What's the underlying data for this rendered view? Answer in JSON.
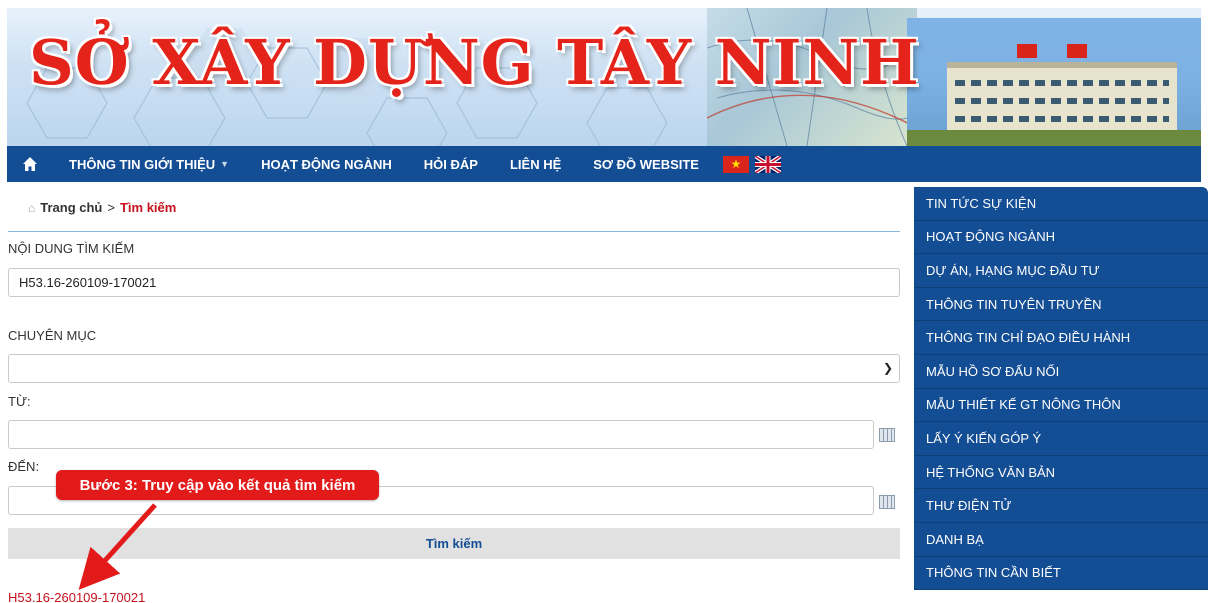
{
  "banner": {
    "title": "SỞ XÂY DỰNG TÂY NINH",
    "title_color": "#e4241b"
  },
  "nav": {
    "home_icon": "home-icon",
    "items": [
      {
        "label": "THÔNG TIN GIỚI THIỆU",
        "has_dropdown": true
      },
      {
        "label": "HOẠT ĐỘNG NGÀNH"
      },
      {
        "label": "HỎI ĐÁP"
      },
      {
        "label": "LIÊN HỆ"
      },
      {
        "label": "SƠ ĐỒ WEBSITE"
      }
    ],
    "background": "#134d94"
  },
  "breadcrumb": {
    "home": "Trang chủ",
    "separator": ">",
    "current": "Tìm kiếm"
  },
  "form": {
    "content_label": "NỘI DUNG TÌM KIẾM",
    "content_value": "H53.16-260109-170021",
    "category_label": "CHUYÊN MỤC",
    "category_value": "",
    "from_label": "TỪ:",
    "from_value": "",
    "to_label": "ĐẾN:",
    "to_value": "",
    "search_button": "Tìm kiếm"
  },
  "callout": {
    "text": "Bước 3: Truy cập vào kết quả tìm kiếm",
    "color": "#e21a1a"
  },
  "results": [
    {
      "text": "H53.16-260109-170021"
    }
  ],
  "sidebar": {
    "items": [
      {
        "label": "TIN TỨC SỰ KIỆN"
      },
      {
        "label": "HOẠT ĐỘNG NGÀNH"
      },
      {
        "label": "DỰ ÁN, HẠNG MỤC ĐẦU TƯ"
      },
      {
        "label": "THÔNG TIN TUYÊN TRUYỀN"
      },
      {
        "label": "THÔNG TIN CHỈ ĐẠO ĐIỀU HÀNH"
      },
      {
        "label": "MẪU HỒ SƠ ĐẤU NỐI"
      },
      {
        "label": "MẪU THIẾT KẾ GT NÔNG THÔN"
      },
      {
        "label": "LẤY Ý KIẾN GÓP Ý"
      },
      {
        "label": "HỆ THỐNG VĂN BẢN"
      },
      {
        "label": "THƯ ĐIỆN TỬ"
      },
      {
        "label": "DANH BẠ"
      },
      {
        "label": "THÔNG TIN CẦN BIẾT"
      }
    ]
  }
}
